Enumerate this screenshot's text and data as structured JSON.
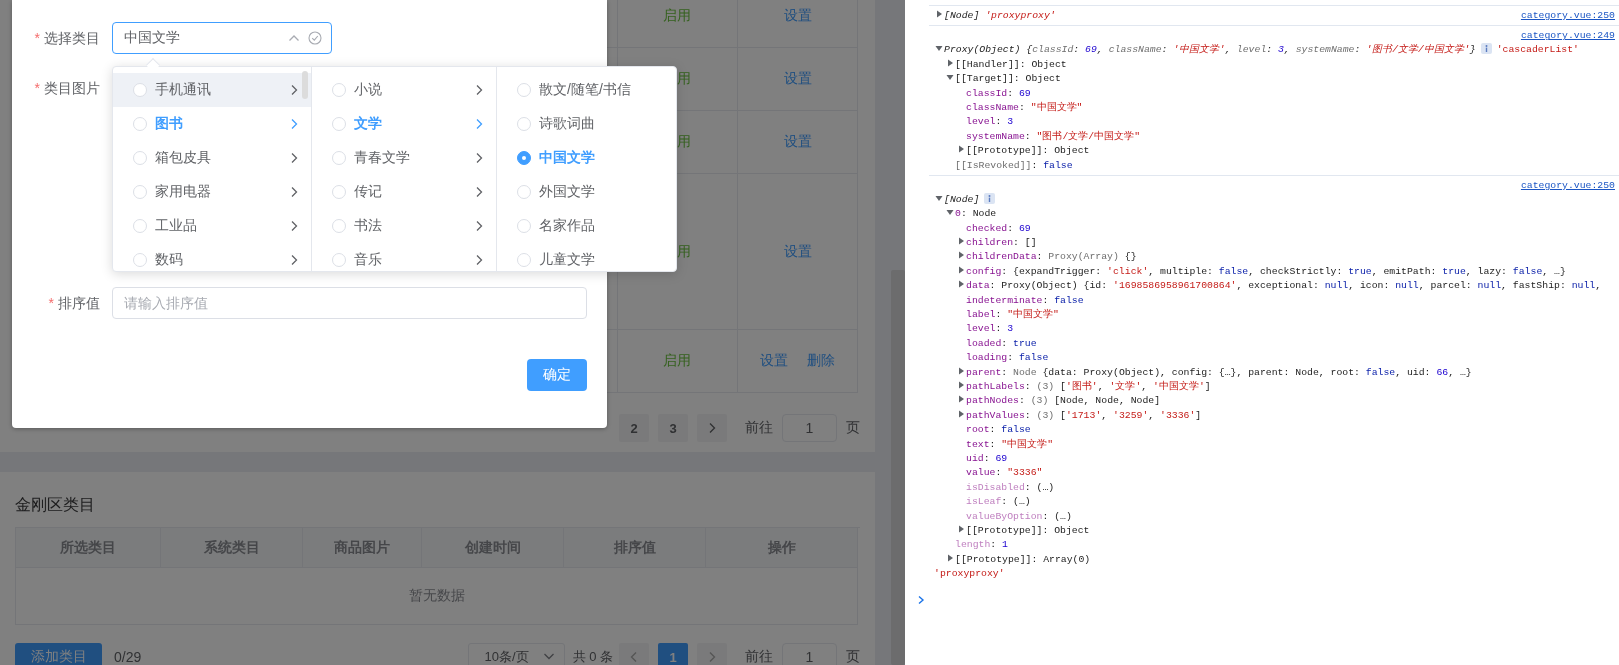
{
  "background_page": {
    "table": {
      "rows": [
        {
          "column_1": "启用",
          "column_2": [
            {
              "label": "设置"
            }
          ]
        },
        {
          "column_1": "用",
          "column_2": [
            {
              "label": "设置"
            }
          ]
        },
        {
          "column_1": "用",
          "column_2": [
            {
              "label": "设置"
            }
          ]
        },
        {
          "column_1": "用",
          "column_2": [
            {
              "label": "设置"
            }
          ]
        },
        {
          "column_1": "启用",
          "column_2": [
            {
              "label": "设置"
            },
            {
              "label": "删除"
            }
          ]
        }
      ]
    },
    "pagination": {
      "pages": [
        {
          "label": "2",
          "selected": false
        },
        {
          "label": "3",
          "selected": false
        }
      ],
      "goto_label": "前往",
      "goto_value": "1",
      "page_suffix": "页"
    },
    "section": {
      "title": "金刚区类目",
      "columns": [
        "所选类目",
        "系统类目",
        "商品图片",
        "创建时间",
        "排序值",
        "操作"
      ],
      "empty_text": "暂无数据",
      "add_button": "添加类目",
      "count": "0/29",
      "page_size": "10条/页",
      "total": "共 0 条",
      "pages": [
        {
          "label": "1",
          "selected": true
        }
      ],
      "goto_label": "前往",
      "goto_value": "1",
      "page_suffix": "页"
    }
  },
  "dialog": {
    "fields": [
      {
        "kind": "cascader",
        "required_mark": "*",
        "label": "选择类目",
        "value": "中国文学"
      },
      {
        "kind": "upload",
        "required_mark": "*",
        "label": "类目图片"
      },
      {
        "kind": "input",
        "required_mark": "*",
        "label": "排序值",
        "placeholder": "请输入排序值"
      }
    ],
    "confirm_button": "确定"
  },
  "cascader_menu": {
    "columns": [
      {
        "items": [
          {
            "label": "手机通讯",
            "expandable": true,
            "selected": false,
            "checked": false,
            "hovered": true
          },
          {
            "label": "图书",
            "expandable": true,
            "selected": true,
            "checked": false,
            "hovered": false
          },
          {
            "label": "箱包皮具",
            "expandable": true,
            "selected": false,
            "checked": false,
            "hovered": false
          },
          {
            "label": "家用电器",
            "expandable": true,
            "selected": false,
            "checked": false,
            "hovered": false
          },
          {
            "label": "工业品",
            "expandable": true,
            "selected": false,
            "checked": false,
            "hovered": false
          },
          {
            "label": "数码",
            "expandable": true,
            "selected": false,
            "checked": false,
            "hovered": false
          }
        ]
      },
      {
        "items": [
          {
            "label": "小说",
            "expandable": true,
            "selected": false,
            "checked": false,
            "hovered": false
          },
          {
            "label": "文学",
            "expandable": true,
            "selected": true,
            "checked": false,
            "hovered": false
          },
          {
            "label": "青春文学",
            "expandable": true,
            "selected": false,
            "checked": false,
            "hovered": false
          },
          {
            "label": "传记",
            "expandable": true,
            "selected": false,
            "checked": false,
            "hovered": false
          },
          {
            "label": "书法",
            "expandable": true,
            "selected": false,
            "checked": false,
            "hovered": false
          },
          {
            "label": "音乐",
            "expandable": true,
            "selected": false,
            "checked": false,
            "hovered": false
          }
        ]
      },
      {
        "items": [
          {
            "label": "散文/随笔/书信",
            "expandable": false,
            "selected": false,
            "checked": false,
            "hovered": false
          },
          {
            "label": "诗歌词曲",
            "expandable": false,
            "selected": false,
            "checked": false,
            "hovered": false
          },
          {
            "label": "中国文学",
            "expandable": false,
            "selected": true,
            "checked": true,
            "hovered": false
          },
          {
            "label": "外国文学",
            "expandable": false,
            "selected": false,
            "checked": false,
            "hovered": false
          },
          {
            "label": "名家作品",
            "expandable": false,
            "selected": false,
            "checked": false,
            "hovered": false
          },
          {
            "label": "儿童文学",
            "expandable": false,
            "selected": false,
            "checked": false,
            "hovered": false
          }
        ]
      }
    ]
  },
  "console": {
    "messages": [
      {
        "source": "category.vue:250",
        "lines": [
          {
            "expanded": false,
            "italic": true,
            "segments": [
              {
                "kind": "plain",
                "text": "[Node] "
              },
              {
                "kind": "string",
                "text": "'proxyproxy'"
              }
            ]
          }
        ]
      },
      {
        "source": "category.vue:249",
        "lines": [
          {
            "expanded": true,
            "italic": true,
            "info": true,
            "segments": [
              {
                "kind": "plain",
                "text": "Proxy(Object) {"
              },
              {
                "kind": "muted",
                "text": "classId"
              },
              {
                "kind": "plain",
                "text": ": "
              },
              {
                "kind": "number",
                "text": "69"
              },
              {
                "kind": "plain",
                "text": ", "
              },
              {
                "kind": "muted",
                "text": "className"
              },
              {
                "kind": "plain",
                "text": ": "
              },
              {
                "kind": "string",
                "text": "'中国文学'"
              },
              {
                "kind": "plain",
                "text": ", "
              },
              {
                "kind": "muted",
                "text": "level"
              },
              {
                "kind": "plain",
                "text": ": "
              },
              {
                "kind": "number",
                "text": "3"
              },
              {
                "kind": "plain",
                "text": ", "
              },
              {
                "kind": "muted",
                "text": "systemName"
              },
              {
                "kind": "plain",
                "text": ": "
              },
              {
                "kind": "string",
                "text": "'图书/文学/中国文学'"
              },
              {
                "kind": "plain",
                "text": "}"
              }
            ],
            "trailing": [
              {
                "kind": "string",
                "text": "'cascaderList'"
              }
            ],
            "children": [
              {
                "expanded": false,
                "segments": [
                  {
                    "kind": "plain",
                    "text": "[[Handler]]: Object"
                  }
                ]
              },
              {
                "expanded": true,
                "segments": [
                  {
                    "kind": "plain",
                    "text": "[[Target]]: Object"
                  }
                ],
                "children": [
                  {
                    "segments": [
                      {
                        "kind": "name",
                        "text": "classId"
                      },
                      {
                        "kind": "plain",
                        "text": ": "
                      },
                      {
                        "kind": "number",
                        "text": "69"
                      }
                    ]
                  },
                  {
                    "segments": [
                      {
                        "kind": "name",
                        "text": "className"
                      },
                      {
                        "kind": "plain",
                        "text": ": "
                      },
                      {
                        "kind": "string",
                        "text": "\"中国文学\""
                      }
                    ]
                  },
                  {
                    "segments": [
                      {
                        "kind": "name",
                        "text": "level"
                      },
                      {
                        "kind": "plain",
                        "text": ": "
                      },
                      {
                        "kind": "number",
                        "text": "3"
                      }
                    ]
                  },
                  {
                    "segments": [
                      {
                        "kind": "name",
                        "text": "systemName"
                      },
                      {
                        "kind": "plain",
                        "text": ": "
                      },
                      {
                        "kind": "string",
                        "text": "\"图书/文学/中国文学\""
                      }
                    ]
                  },
                  {
                    "expanded": false,
                    "segments": [
                      {
                        "kind": "plain",
                        "text": "[[Prototype]]: Object"
                      }
                    ]
                  }
                ]
              },
              {
                "segments": [
                  {
                    "kind": "muted",
                    "text": "[[IsRevoked]]"
                  },
                  {
                    "kind": "plain",
                    "text": ": "
                  },
                  {
                    "kind": "keyword",
                    "text": "false"
                  }
                ]
              }
            ]
          }
        ]
      },
      {
        "source": "category.vue:250",
        "lines": [
          {
            "expanded": true,
            "italic": true,
            "info": true,
            "segments": [
              {
                "kind": "plain",
                "text": "[Node]"
              }
            ],
            "children": [
              {
                "expanded": true,
                "segments": [
                  {
                    "kind": "name",
                    "text": "0"
                  },
                  {
                    "kind": "plain",
                    "text": ": Node"
                  }
                ],
                "children": [
                  {
                    "segments": [
                      {
                        "kind": "name",
                        "text": "checked"
                      },
                      {
                        "kind": "plain",
                        "text": ": "
                      },
                      {
                        "kind": "number",
                        "text": "69"
                      }
                    ]
                  },
                  {
                    "expanded": false,
                    "segments": [
                      {
                        "kind": "name",
                        "text": "children"
                      },
                      {
                        "kind": "plain",
                        "text": ": []"
                      }
                    ]
                  },
                  {
                    "expanded": false,
                    "segments": [
                      {
                        "kind": "name",
                        "text": "childrenData"
                      },
                      {
                        "kind": "plain",
                        "text": ": "
                      },
                      {
                        "kind": "muted",
                        "text": "Proxy(Array) "
                      },
                      {
                        "kind": "plain",
                        "text": "{}"
                      }
                    ]
                  },
                  {
                    "expanded": false,
                    "segments": [
                      {
                        "kind": "name",
                        "text": "config"
                      },
                      {
                        "kind": "plain",
                        "text": ": {expandTrigger: "
                      },
                      {
                        "kind": "string",
                        "text": "'click'"
                      },
                      {
                        "kind": "plain",
                        "text": ", multiple: "
                      },
                      {
                        "kind": "keyword",
                        "text": "false"
                      },
                      {
                        "kind": "plain",
                        "text": ", checkStrictly: "
                      },
                      {
                        "kind": "keyword",
                        "text": "true"
                      },
                      {
                        "kind": "plain",
                        "text": ", emitPath: "
                      },
                      {
                        "kind": "keyword",
                        "text": "true"
                      },
                      {
                        "kind": "plain",
                        "text": ", lazy: "
                      },
                      {
                        "kind": "keyword",
                        "text": "false"
                      },
                      {
                        "kind": "plain",
                        "text": ", …}"
                      }
                    ]
                  },
                  {
                    "expanded": false,
                    "segments": [
                      {
                        "kind": "name",
                        "text": "data"
                      },
                      {
                        "kind": "plain",
                        "text": ": Proxy(Object) {id: "
                      },
                      {
                        "kind": "string",
                        "text": "'1698586958961700864'"
                      },
                      {
                        "kind": "plain",
                        "text": ", exceptional: "
                      },
                      {
                        "kind": "keyword",
                        "text": "null"
                      },
                      {
                        "kind": "plain",
                        "text": ", icon: "
                      },
                      {
                        "kind": "keyword",
                        "text": "null"
                      },
                      {
                        "kind": "plain",
                        "text": ", parcel: "
                      },
                      {
                        "kind": "keyword",
                        "text": "null"
                      },
                      {
                        "kind": "plain",
                        "text": ", fastShip: "
                      },
                      {
                        "kind": "keyword",
                        "text": "null"
                      },
                      {
                        "kind": "plain",
                        "text": ","
                      }
                    ]
                  },
                  {
                    "segments": [
                      {
                        "kind": "name",
                        "text": "indeterminate"
                      },
                      {
                        "kind": "plain",
                        "text": ": "
                      },
                      {
                        "kind": "keyword",
                        "text": "false"
                      }
                    ]
                  },
                  {
                    "segments": [
                      {
                        "kind": "name",
                        "text": "label"
                      },
                      {
                        "kind": "plain",
                        "text": ": "
                      },
                      {
                        "kind": "string",
                        "text": "\"中国文学\""
                      }
                    ]
                  },
                  {
                    "segments": [
                      {
                        "kind": "name",
                        "text": "level"
                      },
                      {
                        "kind": "plain",
                        "text": ": "
                      },
                      {
                        "kind": "number",
                        "text": "3"
                      }
                    ]
                  },
                  {
                    "segments": [
                      {
                        "kind": "name",
                        "text": "loaded"
                      },
                      {
                        "kind": "plain",
                        "text": ": "
                      },
                      {
                        "kind": "keyword",
                        "text": "true"
                      }
                    ]
                  },
                  {
                    "segments": [
                      {
                        "kind": "name",
                        "text": "loading"
                      },
                      {
                        "kind": "plain",
                        "text": ": "
                      },
                      {
                        "kind": "keyword",
                        "text": "false"
                      }
                    ]
                  },
                  {
                    "expanded": false,
                    "segments": [
                      {
                        "kind": "name",
                        "text": "parent"
                      },
                      {
                        "kind": "plain",
                        "text": ": "
                      },
                      {
                        "kind": "muted",
                        "text": "Node "
                      },
                      {
                        "kind": "plain",
                        "text": "{data: Proxy(Object), config: {…}, parent: Node, root: "
                      },
                      {
                        "kind": "keyword",
                        "text": "false"
                      },
                      {
                        "kind": "plain",
                        "text": ", uid: "
                      },
                      {
                        "kind": "number",
                        "text": "66"
                      },
                      {
                        "kind": "plain",
                        "text": ", …}"
                      }
                    ]
                  },
                  {
                    "expanded": false,
                    "segments": [
                      {
                        "kind": "name",
                        "text": "pathLabels"
                      },
                      {
                        "kind": "plain",
                        "text": ": "
                      },
                      {
                        "kind": "muted",
                        "text": "(3) "
                      },
                      {
                        "kind": "plain",
                        "text": "["
                      },
                      {
                        "kind": "string",
                        "text": "'图书'"
                      },
                      {
                        "kind": "plain",
                        "text": ", "
                      },
                      {
                        "kind": "string",
                        "text": "'文学'"
                      },
                      {
                        "kind": "plain",
                        "text": ", "
                      },
                      {
                        "kind": "string",
                        "text": "'中国文学'"
                      },
                      {
                        "kind": "plain",
                        "text": "]"
                      }
                    ]
                  },
                  {
                    "expanded": false,
                    "segments": [
                      {
                        "kind": "name",
                        "text": "pathNodes"
                      },
                      {
                        "kind": "plain",
                        "text": ": "
                      },
                      {
                        "kind": "muted",
                        "text": "(3) "
                      },
                      {
                        "kind": "plain",
                        "text": "[Node, Node, Node]"
                      }
                    ]
                  },
                  {
                    "expanded": false,
                    "segments": [
                      {
                        "kind": "name",
                        "text": "pathValues"
                      },
                      {
                        "kind": "plain",
                        "text": ": "
                      },
                      {
                        "kind": "muted",
                        "text": "(3) "
                      },
                      {
                        "kind": "plain",
                        "text": "["
                      },
                      {
                        "kind": "string",
                        "text": "'1713'"
                      },
                      {
                        "kind": "plain",
                        "text": ", "
                      },
                      {
                        "kind": "string",
                        "text": "'3259'"
                      },
                      {
                        "kind": "plain",
                        "text": ", "
                      },
                      {
                        "kind": "string",
                        "text": "'3336'"
                      },
                      {
                        "kind": "plain",
                        "text": "]"
                      }
                    ]
                  },
                  {
                    "segments": [
                      {
                        "kind": "name",
                        "text": "root"
                      },
                      {
                        "kind": "plain",
                        "text": ": "
                      },
                      {
                        "kind": "keyword",
                        "text": "false"
                      }
                    ]
                  },
                  {
                    "segments": [
                      {
                        "kind": "name",
                        "text": "text"
                      },
                      {
                        "kind": "plain",
                        "text": ": "
                      },
                      {
                        "kind": "string",
                        "text": "\"中国文学\""
                      }
                    ]
                  },
                  {
                    "segments": [
                      {
                        "kind": "name",
                        "text": "uid"
                      },
                      {
                        "kind": "plain",
                        "text": ": "
                      },
                      {
                        "kind": "number",
                        "text": "69"
                      }
                    ]
                  },
                  {
                    "segments": [
                      {
                        "kind": "name",
                        "text": "value"
                      },
                      {
                        "kind": "plain",
                        "text": ": "
                      },
                      {
                        "kind": "string",
                        "text": "\"3336\""
                      }
                    ]
                  },
                  {
                    "segments": [
                      {
                        "kind": "dim",
                        "text": "isDisabled"
                      },
                      {
                        "kind": "plain",
                        "text": ":  (…)"
                      }
                    ]
                  },
                  {
                    "segments": [
                      {
                        "kind": "dim",
                        "text": "isLeaf"
                      },
                      {
                        "kind": "plain",
                        "text": ":  (…)"
                      }
                    ]
                  },
                  {
                    "segments": [
                      {
                        "kind": "dim",
                        "text": "valueByOption"
                      },
                      {
                        "kind": "plain",
                        "text": ":  (…)"
                      }
                    ]
                  },
                  {
                    "expanded": false,
                    "segments": [
                      {
                        "kind": "plain",
                        "text": "[[Prototype]]: Object"
                      }
                    ]
                  }
                ]
              },
              {
                "segments": [
                  {
                    "kind": "dim",
                    "text": "length"
                  },
                  {
                    "kind": "plain",
                    "text": ": "
                  },
                  {
                    "kind": "number",
                    "text": "1"
                  }
                ]
              },
              {
                "expanded": false,
                "segments": [
                  {
                    "kind": "plain",
                    "text": "[[Prototype]]: Array(0)"
                  }
                ]
              }
            ]
          },
          {
            "segments": [
              {
                "kind": "string",
                "text": "'proxyproxy'"
              }
            ]
          }
        ]
      }
    ]
  }
}
